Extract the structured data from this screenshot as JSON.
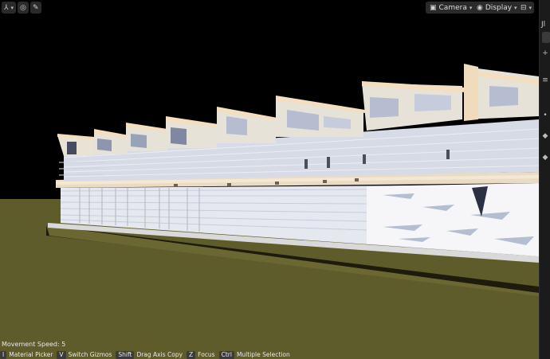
{
  "toolbar": {
    "left": [
      {
        "icon": "axes-icon",
        "glyph": "⚲"
      },
      {
        "icon": "globe-icon",
        "glyph": "🌐"
      },
      {
        "icon": "pen-icon",
        "glyph": "✎"
      }
    ],
    "camera_label": "Camera",
    "display_label": "Display"
  },
  "right_panel": {
    "tab_text": "Jl"
  },
  "status": {
    "movement_speed": "Movement Speed: 5"
  },
  "shortcuts": [
    {
      "key": "I",
      "label": "Material Picker"
    },
    {
      "key": "V",
      "label": "Switch Gizmos"
    },
    {
      "key": "Shift",
      "label": "Drag Axis Copy"
    },
    {
      "key": "Z",
      "label": "Focus"
    },
    {
      "key": "Ctrl",
      "label": "Multiple Selection"
    }
  ],
  "colors": {
    "sky": "#000000",
    "ground": "#5f5c2c",
    "roof": "#f1dec0",
    "glass": "#dfe3ee",
    "panel": "#1b1b1b"
  }
}
